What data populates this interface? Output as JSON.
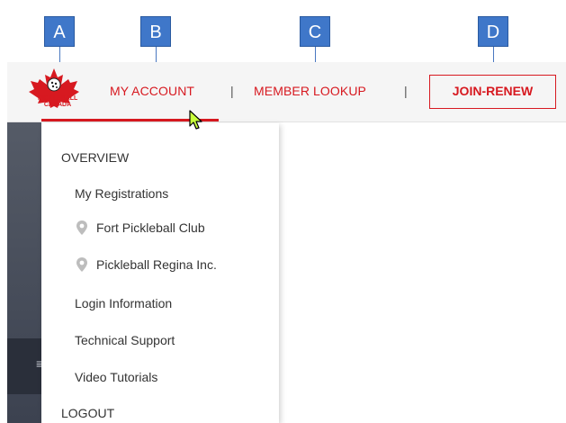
{
  "callouts": [
    {
      "label": "A"
    },
    {
      "label": "B"
    },
    {
      "label": "C"
    },
    {
      "label": "D"
    }
  ],
  "header": {
    "logo": {
      "text_line1": "PICKLEBALL",
      "text_line2": "CANADA",
      "brand_color": "#d71920"
    },
    "nav": {
      "my_account": "MY ACCOUNT",
      "separator": "|",
      "member_lookup": "MEMBER LOOKUP"
    },
    "join_button": "JOIN-RENEW"
  },
  "dropdown": {
    "overview": "OVERVIEW",
    "items": [
      {
        "label": "My Registrations",
        "icon": null
      },
      {
        "label": "Fort Pickleball Club",
        "icon": "location-pin-icon"
      },
      {
        "label": "Pickleball Regina Inc.",
        "icon": "location-pin-icon"
      },
      {
        "label": "Login Information",
        "icon": null
      },
      {
        "label": "Technical Support",
        "icon": null
      },
      {
        "label": "Video Tutorials",
        "icon": null
      }
    ],
    "logout": "LOGOUT"
  },
  "colors": {
    "accent": "#d71920",
    "callout_blue": "#3f77c9",
    "header_bg": "#f5f5f5",
    "sidebar_dark": "#3c4250"
  }
}
